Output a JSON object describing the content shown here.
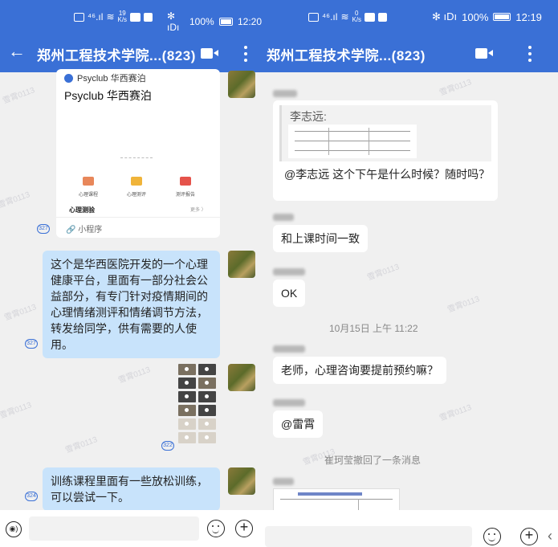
{
  "left": {
    "status": {
      "signal": "⁴⁶.ıl",
      "speed_value": "19",
      "speed_unit": "K/s",
      "right_icons": "✻ ıDı",
      "battery": "100%",
      "time": "12:20"
    },
    "nav": {
      "back": "←",
      "title": "郑州工程技术学院...(823)"
    },
    "card": {
      "source": "Psyclub 华西赛泊",
      "title": "Psyclub 华西赛泊",
      "features": [
        "心理课程",
        "心理测评",
        "测评报告"
      ],
      "section": "心理测验",
      "section_more": "更多 〉",
      "miniprogram": "小程序",
      "read_count": "327"
    },
    "msg1": {
      "text": "这个是华西医院开发的一个心理健康平台，里面有一部分社会公益部分，有专门针对疫情期间的心理情绪测评和情绪调节方法，转发给同学，供有需要的人使用。",
      "read_count": "327"
    },
    "image_msg": {
      "read_count": "322"
    },
    "msg2": {
      "text": "训练课程里面有一些放松训练，可以尝试一下。",
      "read_count": "324"
    },
    "watermark": "雪霄0113"
  },
  "right": {
    "status": {
      "signal": "⁴⁶.ıl",
      "speed_value": "0",
      "speed_unit": "K/s",
      "right_icons": "✻ ıDı",
      "battery": "100%",
      "time": "12:19"
    },
    "nav": {
      "title": "郑州工程技术学院...(823)"
    },
    "quote": {
      "label": "李志远:",
      "text": "@李志远 这个下午是什么时候？随时吗？"
    },
    "msg_a": "和上课时间一致",
    "msg_b": "OK",
    "timestamp": "10月15日  上午 11:22",
    "msg_c": "老师，心理咨询要提前预约嘛？",
    "msg_d": "@雷霄",
    "system_note": "崔珂莹撤回了一条消息",
    "watermark": "雪霄0113"
  },
  "colors": {
    "header": "#3a70d6",
    "bubble_sent": "#c8e3fb",
    "bubble_received": "#ffffff",
    "background": "#f0f0f0"
  }
}
